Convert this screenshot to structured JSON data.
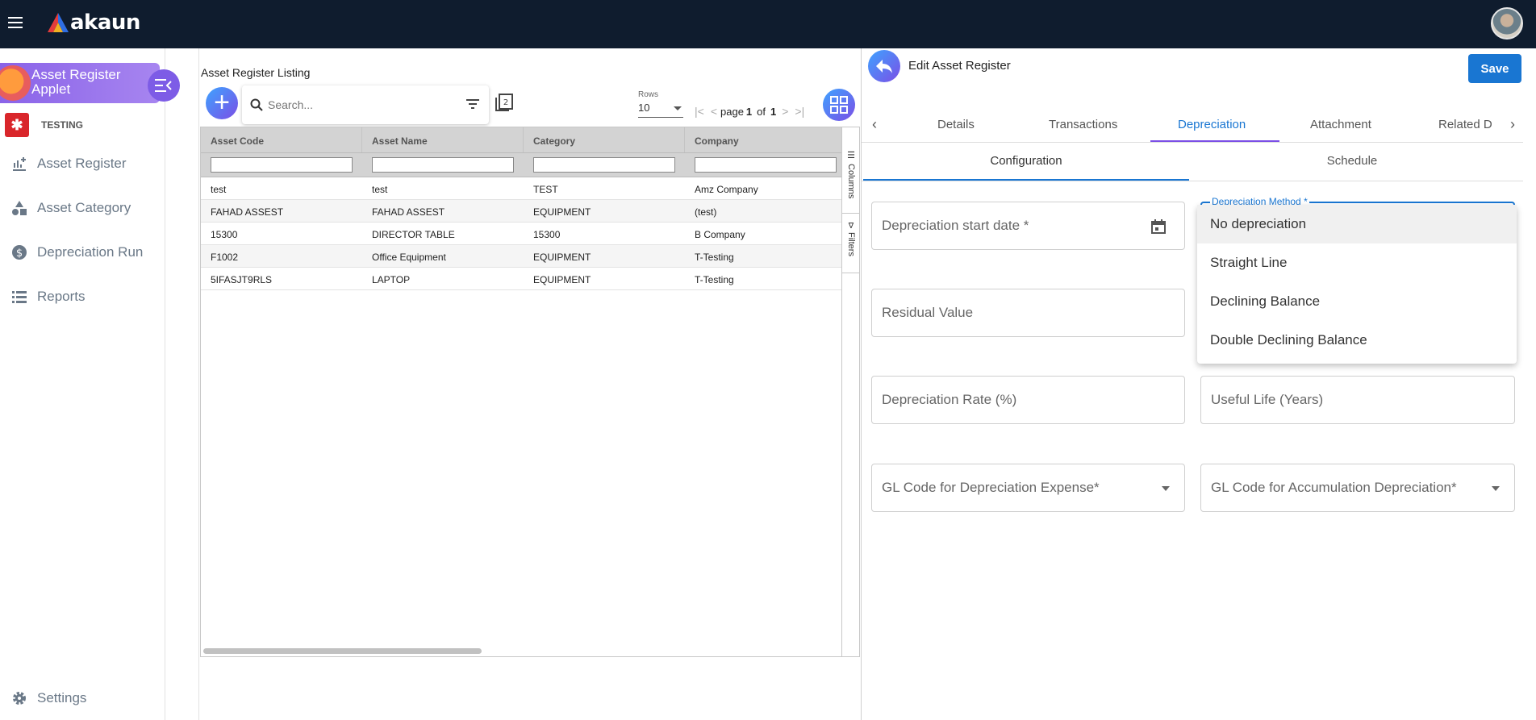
{
  "app": {
    "brand": "akaun"
  },
  "sidebar": {
    "applet_title": "Asset Register Applet",
    "tenant": "TESTING",
    "items": [
      {
        "label": "Asset Register",
        "icon": "chart-add-icon"
      },
      {
        "label": "Asset Category",
        "icon": "shapes-icon"
      },
      {
        "label": "Depreciation Run",
        "icon": "dollar-circle-icon"
      },
      {
        "label": "Reports",
        "icon": "list-icon"
      }
    ],
    "settings": "Settings"
  },
  "listing": {
    "title": "Asset Register Listing",
    "search_placeholder": "Search...",
    "rows_label": "Rows",
    "rows_value": "10",
    "page_word": "page",
    "page_current": "1",
    "of_word": "of",
    "page_total": "1",
    "columns": [
      "Asset Code",
      "Asset Name",
      "Category",
      "Company"
    ],
    "rows": [
      [
        "test",
        "test",
        "TEST",
        "Amz Company"
      ],
      [
        "FAHAD ASSEST",
        "FAHAD ASSEST",
        "EQUIPMENT",
        "(test)"
      ],
      [
        "15300",
        "DIRECTOR TABLE",
        "15300",
        "B Company"
      ],
      [
        "F1002",
        "Office Equipment",
        "EQUIPMENT",
        "T-Testing"
      ],
      [
        "5IFASJT9RLS",
        "LAPTOP",
        "EQUIPMENT",
        "T-Testing"
      ]
    ],
    "side_tabs": {
      "columns": "Columns",
      "filters": "Filters"
    }
  },
  "edit": {
    "title": "Edit Asset Register",
    "save_label": "Save",
    "tabs": [
      "Details",
      "Transactions",
      "Depreciation",
      "Attachment",
      "Related D"
    ],
    "active_tab": "Depreciation",
    "subtabs": [
      "Configuration",
      "Schedule"
    ],
    "fields": {
      "start_date": "Depreciation start date *",
      "method_label": "Depreciation Method *",
      "residual": "Residual Value",
      "rate": "Depreciation Rate (%)",
      "useful_life": "Useful Life (Years)",
      "gl_expense": "GL Code for Depreciation Expense*",
      "gl_accum": "GL Code for Accumulation Depreciation*"
    },
    "method_options": [
      "No depreciation",
      "Straight Line",
      "Declining Balance",
      "Double Declining Balance"
    ]
  },
  "colors": {
    "topbar": "#0f1c2e",
    "accent": "#1976d2",
    "applet": "#8a63e8"
  }
}
